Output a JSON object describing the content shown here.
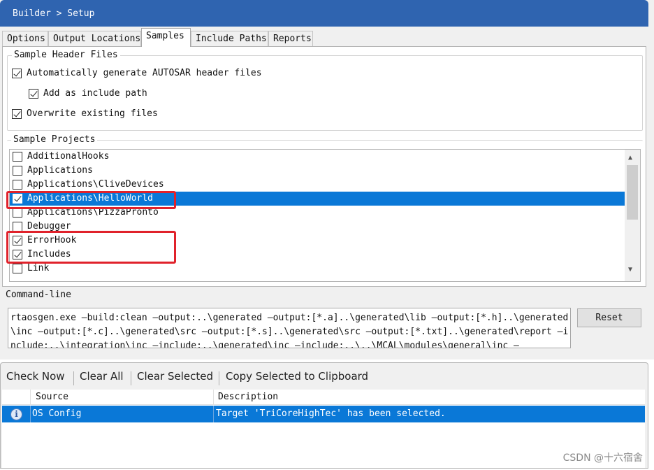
{
  "title": "Builder > Setup",
  "tabs": [
    "Options",
    "Output Locations",
    "Samples",
    "Include Paths",
    "Reports"
  ],
  "header_files": {
    "legend": "Sample Header Files",
    "items": [
      {
        "label": "Automatically generate AUTOSAR header files",
        "checked": true
      },
      {
        "label": "Add as include path",
        "checked": true
      },
      {
        "label": "Overwrite existing files",
        "checked": true
      }
    ]
  },
  "projects": {
    "legend": "Sample Projects",
    "items": [
      {
        "label": "AdditionalHooks",
        "checked": false,
        "selected": false
      },
      {
        "label": "Applications",
        "checked": false,
        "selected": false
      },
      {
        "label": "Applications\\CliveDevices",
        "checked": false,
        "selected": false
      },
      {
        "label": "Applications\\HelloWorld",
        "checked": true,
        "selected": true
      },
      {
        "label": "Applications\\PizzaPronto",
        "checked": false,
        "selected": false
      },
      {
        "label": "Debugger",
        "checked": false,
        "selected": false
      },
      {
        "label": "ErrorHook",
        "checked": true,
        "selected": false
      },
      {
        "label": "Includes",
        "checked": true,
        "selected": false
      },
      {
        "label": "Link",
        "checked": false,
        "selected": false
      }
    ]
  },
  "command_line": {
    "label": "Command-line",
    "text": "rtaosgen.exe —build:clean —output:..\\generated —output:[*.a]..\\generated\\lib —output:[*.h]..\\generated\\inc —output:[*.c]..\\generated\\src —output:[*.s]..\\generated\\src —output:[*.txt]..\\generated\\report —include:..\\integration\\inc —include:..\\generated\\inc —include:..\\..\\MCAL\\modules\\general\\inc —",
    "reset_label": "Reset"
  },
  "toolbar": {
    "check_now": "Check Now",
    "clear_all": "Clear All",
    "clear_selected": "Clear Selected",
    "copy_selected": "Copy Selected to Clipboard"
  },
  "messages": {
    "headers": {
      "source": "Source",
      "description": "Description"
    },
    "rows": [
      {
        "icon": "info-icon",
        "icon_glyph": "i",
        "source": "OS Config",
        "description": "Target 'TriCoreHighTec' has been selected."
      }
    ]
  },
  "watermark": "CSDN @十六宿舍",
  "colors": {
    "titlebar": "#2f64b0",
    "selection": "#0a78d7",
    "highlight_box": "#e0222b"
  }
}
